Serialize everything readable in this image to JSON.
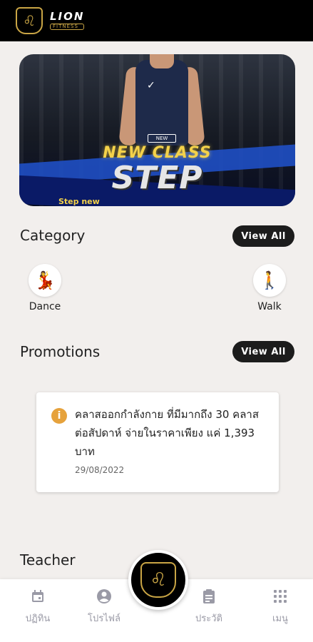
{
  "header": {
    "logo_title": "LION",
    "logo_subtitle": "FITNESS"
  },
  "banner": {
    "tag": "NEW",
    "headline": "NEW CLASS",
    "title": "STEP",
    "subtitle": "Step new"
  },
  "category": {
    "title": "Category",
    "view_all": "View All",
    "items": [
      {
        "label": "Dance",
        "icon": "dancer-icon",
        "glyph": "💃"
      },
      {
        "label": "Walk",
        "icon": "walker-icon",
        "glyph": "🚶"
      }
    ]
  },
  "promotions": {
    "title": "Promotions",
    "view_all": "View All",
    "card": {
      "icon": "info-icon",
      "text": "คลาสออกกำลังกาย ที่มีมากถึง 30 คลาสต่อสัปดาห์ จ่ายในราคาเพียง แค่ 1,393 บาท",
      "date": "29/08/2022"
    }
  },
  "teacher": {
    "title": "Teacher"
  },
  "bottom_nav": {
    "items": [
      {
        "label": "ปฏิทิน",
        "icon": "calendar-icon"
      },
      {
        "label": "โปรไฟล์",
        "icon": "profile-icon"
      },
      {
        "label": "ประวัติ",
        "icon": "history-icon"
      },
      {
        "label": "เมนู",
        "icon": "menu-grid-icon"
      }
    ]
  },
  "colors": {
    "accent_gold": "#c9a545",
    "header_bg": "#000000",
    "page_bg": "#f2efed",
    "button_dark": "#1c1c1c",
    "info_orange": "#e6a23c",
    "nav_inactive": "#9a9aa6"
  }
}
